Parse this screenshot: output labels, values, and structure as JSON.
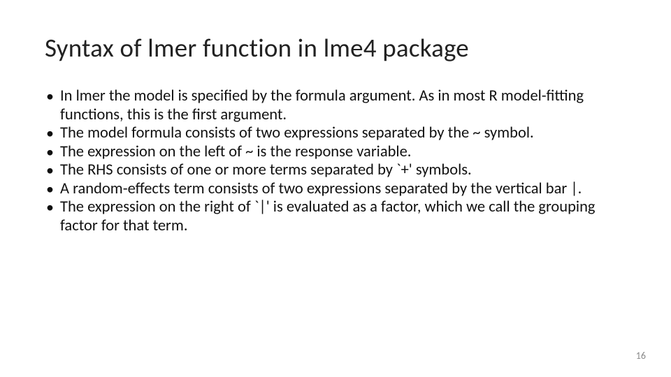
{
  "slide": {
    "title": "Syntax of lmer function in lme4 package",
    "bullets": [
      "In lmer the model is specified by the formula argument. As in most R model-fitting functions, this is the first argument.",
      "The model formula consists of two expressions separated by the ~ symbol.",
      "The expression on the left of ~ is the response variable.",
      "The RHS consists of one or more terms separated by `+' symbols.",
      "A random-effects term consists of two expressions separated by the vertical bar |.",
      "The expression on the right of `|' is evaluated as a factor, which we call the grouping factor for that term."
    ],
    "page_number": "16"
  }
}
